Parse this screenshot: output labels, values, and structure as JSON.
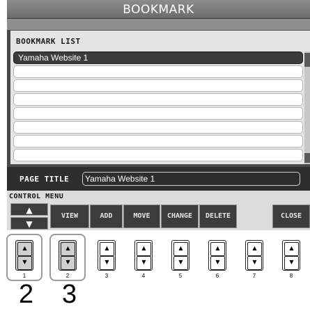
{
  "window": {
    "title": "BOOKMARK"
  },
  "bookmark_list": {
    "header": "BOOKMARK LIST",
    "rows": [
      "Yamaha Website 1",
      "",
      "",
      "",
      "",
      "",
      "",
      ""
    ]
  },
  "page_title": {
    "label": "PAGE TITLE",
    "value": "Yamaha Website 1"
  },
  "control_menu": {
    "label": "CONTROL MENU",
    "up_arrow": "▲",
    "down_arrow": "▼",
    "buttons": [
      "VIEW",
      "ADD",
      "MOVE",
      "CHANGE",
      "DELETE",
      "CLOSE"
    ]
  },
  "physical_buttons": {
    "up_glyph": "▲",
    "down_glyph": "▼",
    "numbers": [
      "1",
      "2",
      "3",
      "4",
      "5",
      "6",
      "7",
      "8"
    ]
  },
  "steps": [
    "2",
    "3"
  ]
}
